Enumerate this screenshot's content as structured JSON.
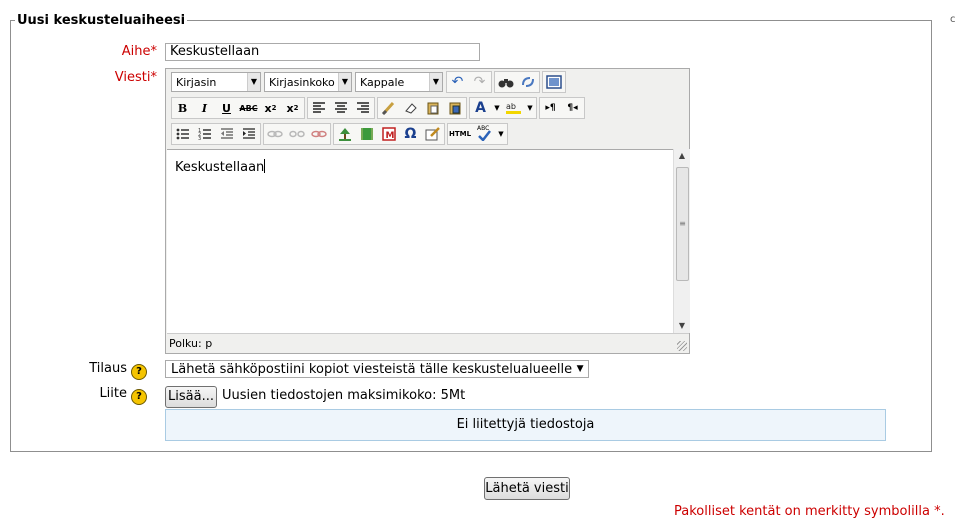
{
  "form": {
    "legend": "Uusi keskusteluaiheesi",
    "required_mark": "*",
    "subject": {
      "label": "Aihe",
      "value": "Keskustellaan"
    },
    "message": {
      "label": "Viesti",
      "content": "Keskustellaan",
      "path": "Polku: p"
    },
    "editor_toolbar": {
      "font_family": "Kirjasin",
      "font_size": "Kirjasinkoko",
      "format": "Kappale",
      "html_label": "HTML",
      "abc_label": "ABC"
    },
    "subscription": {
      "label": "Tilaus",
      "selected": "Lähetä sähköpostiini kopiot viesteistä tälle keskustelualueelle"
    },
    "attachment": {
      "label": "Liite",
      "add_button": "Lisää...",
      "max_size": "Uusien tiedostojen maksimikoko: 5Mt",
      "empty_text": "Ei liitettyjä tiedostoja"
    },
    "submit_label": "Lähetä viesti",
    "required_note": "Pakolliset kentät on merkitty symbolilla",
    "help_icon_text": "?"
  }
}
